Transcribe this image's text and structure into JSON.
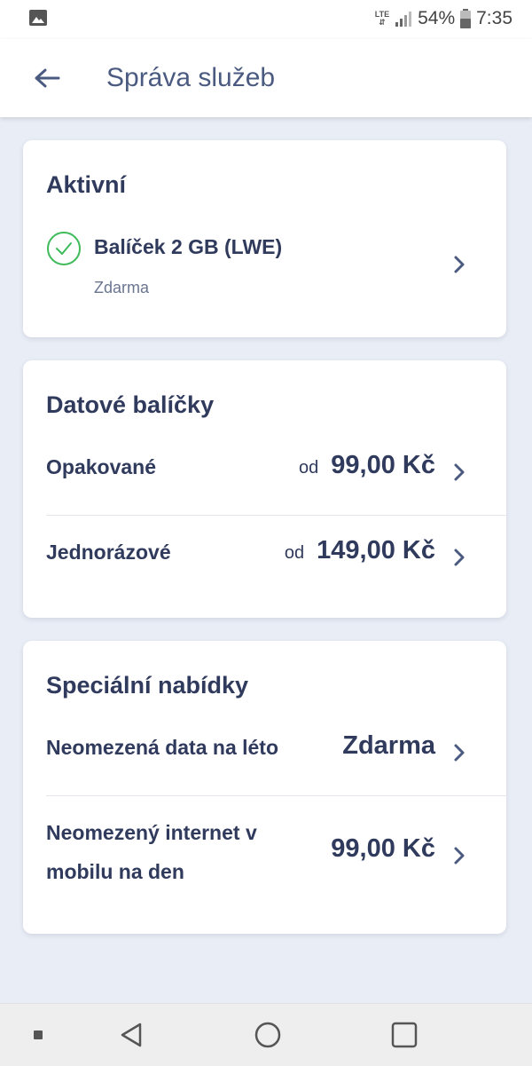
{
  "status_bar": {
    "network": "LTE",
    "battery": "54%",
    "time": "7:35"
  },
  "app_bar": {
    "title": "Správa služeb"
  },
  "active": {
    "title": "Aktivní",
    "item_name": "Balíček 2 GB (LWE)",
    "item_price": "Zdarma"
  },
  "data_packages": {
    "title": "Datové balíčky",
    "rows": [
      {
        "label": "Opakované",
        "prefix": "od",
        "price": "99,00 Kč"
      },
      {
        "label": "Jednorázové",
        "prefix": "od",
        "price": "149,00 Kč"
      }
    ]
  },
  "special_offers": {
    "title": "Speciální nabídky",
    "rows": [
      {
        "label": "Neomezená data na léto",
        "price": "Zdarma"
      },
      {
        "label_line1": "Neomezený internet v",
        "label_line2": "mobilu na den",
        "price": "99,00 Kč"
      }
    ]
  },
  "colors": {
    "background": "#e9edf5",
    "text": "#2f3a5c",
    "check": "#3dbb5a",
    "chevron": "#4a5a80"
  },
  "icons": [
    "image-icon",
    "signal-icon",
    "battery-icon",
    "back-arrow-icon",
    "check-circle-icon",
    "chevron-right-icon",
    "nav-back-icon",
    "nav-home-icon",
    "nav-recents-icon"
  ]
}
